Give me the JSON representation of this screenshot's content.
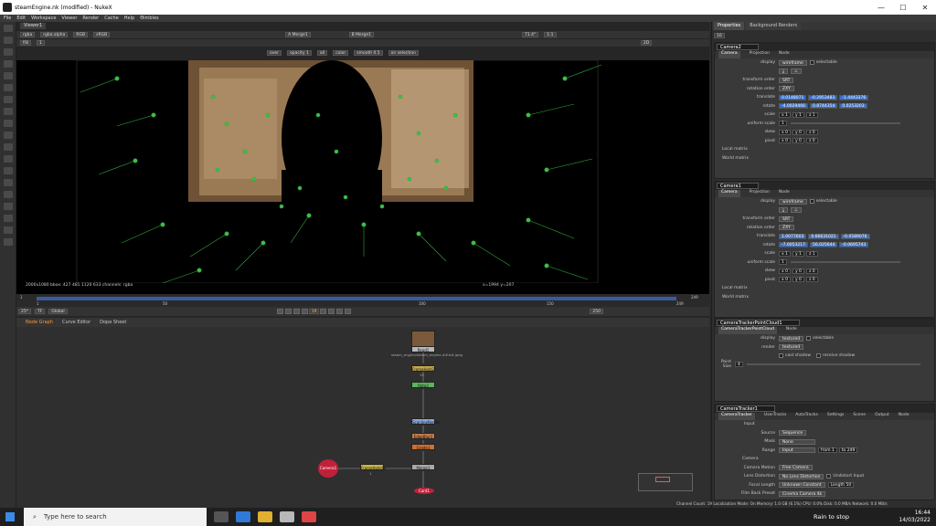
{
  "window": {
    "title": "steamEngine.nk (modified) - NukeX",
    "min": "—",
    "max": "☐",
    "close": "✕"
  },
  "menu": [
    "File",
    "Edit",
    "Workspace",
    "Viewer",
    "Render",
    "Cache",
    "Help",
    "Θimbles"
  ],
  "viewer": {
    "tab": "Viewer1",
    "toolbar1": [
      "rgba",
      "rgba.alpha",
      "RGB",
      "sRGB",
      "A  Merge1",
      "B  Merge1"
    ],
    "toolbar2": [
      "f/8",
      "1",
      "2D"
    ],
    "overlay": [
      "over",
      "opacity 1",
      "all",
      "color",
      "smooth 0.5",
      "on selection"
    ],
    "zoom": "71.4°",
    "ratio": "1:1",
    "status_left": "2000x1080  bbox: 427 481 1120 633 channels: rgba",
    "status_right": "x=1994 y=207"
  },
  "timeline": {
    "ticks": [
      "1",
      "50",
      "100",
      "150",
      "249"
    ],
    "start": "1",
    "end": "249",
    "frame": "19",
    "fps": "25*",
    "tf": "TF",
    "range": "Global",
    "end_field": "250"
  },
  "nodegraph": {
    "tabs": [
      "Node Graph",
      "Curve Editor",
      "Dope Sheet"
    ],
    "nodes": {
      "read": "Read1",
      "read_sub": "steam_engine/steam_engine.####.jpeg",
      "framehold": "FrameHold2",
      "frame_val": "19",
      "roto": "Roto2",
      "scanline": "ScanlineRender",
      "edgeblur": "EdgeBlur1",
      "grade": "Grade1",
      "camera": "Camera1",
      "ctpc": "CameraTrackerPointCloud1",
      "merge": "Merge1",
      "card": "Card1",
      "framehold2": "FrameHold4",
      "framehold2_val": "1"
    }
  },
  "properties": {
    "tabs": [
      "Properties",
      "Background Renders"
    ],
    "count": "10"
  },
  "panels": [
    {
      "name": "Camera2",
      "tabs": [
        "Camera",
        "Projection",
        "Node"
      ],
      "display": "wireframe",
      "selectable": "selectable",
      "transform_order": "SRT",
      "rotation_order": "ZXY",
      "translate": [
        "0.0148071",
        "-0.2953483",
        "-1.4443376"
      ],
      "rotate": [
        "-4.0029466",
        "0.8744354",
        "0.0253203"
      ],
      "scale": [
        "x 1",
        "y 1",
        "z 1"
      ],
      "uniform": "1",
      "skew": [
        "x 0",
        "y 0",
        "z 0"
      ],
      "pivot": [
        "x 0",
        "y 0",
        "z 0"
      ]
    },
    {
      "name": "Camera1",
      "tabs": [
        "Camera",
        "Projection",
        "Node"
      ],
      "display": "wireframe",
      "selectable": "selectable",
      "transform_order": "SRT",
      "rotation_order": "ZXY",
      "translate": [
        "1.0077603",
        "0.66631021",
        "-0.0589076"
      ],
      "rotate": [
        "-7.0053217",
        "56.025644",
        "-0.0695743"
      ],
      "scale": [
        "x 1",
        "y 1",
        "z 1"
      ],
      "uniform": "1",
      "skew": [
        "x 0",
        "y 0",
        "z 0"
      ],
      "pivot": [
        "x 0",
        "y 0",
        "z 0"
      ]
    },
    {
      "name": "CameraTrackerPointCloud1",
      "tabs": [
        "CameraTrackerPointCloud",
        "Node"
      ],
      "display": "textured",
      "render": "textured",
      "cast_shadow": "cast shadow",
      "receive_shadow": "receive shadow",
      "point_size": "4"
    },
    {
      "name": "CameraTracker1",
      "tabs": [
        "CameraTracker",
        "UserTracks",
        "AutoTracks",
        "Settings",
        "Scene",
        "Output",
        "Node"
      ],
      "input_label": "Input",
      "source": "Sequence",
      "mask": "None",
      "range": "Input",
      "from": "from 1",
      "to": "to 249",
      "camera_label": "Camera",
      "camera_motion": "Free Camera",
      "lens_distortion": "No Lens Distortion",
      "undistort": "Undistort Input",
      "focal_length": "Unknown Constant",
      "length": "Length 50",
      "film_back": "Cinema Camera 4k"
    }
  ],
  "labels": {
    "display": "display",
    "transform_order": "transform order",
    "rotation_order": "rotation order",
    "translate": "translate",
    "rotate": "rotate",
    "scale": "scale",
    "uniform": "uniform scale",
    "skew": "skew",
    "pivot": "pivot",
    "local": "Local matrix",
    "world": "World matrix",
    "render": "render",
    "point_size": "Point Size",
    "source": "Source",
    "mask": "Mask",
    "range": "Range",
    "camera_motion": "Camera Motion",
    "lens": "Lens Distortion",
    "focal": "Focal Length",
    "film": "Film Back Preset"
  },
  "statusbar": "Channel Count: 19  Localization Mode: On  Memory: 1.0 GB (6.1%)  CPU: 0.0%  Disk: 0.0 MB/s  Network: 0.0 MB/s",
  "taskbar": {
    "search": "Type here to search",
    "weather": "Rain to stop",
    "time": "16:44",
    "date": "14/03/2022"
  }
}
